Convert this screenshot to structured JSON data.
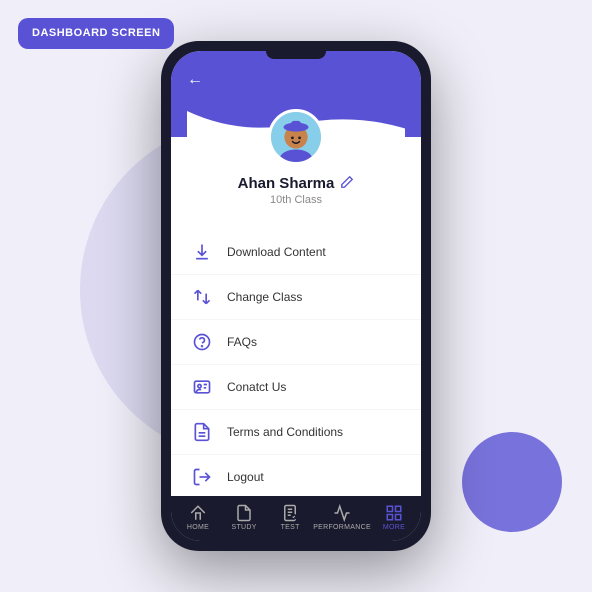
{
  "dashboard_label": "DASHBOARD\nSCREEN",
  "header": {
    "back_label": "←",
    "username": "Ahan Sharma",
    "user_class": "10th Class",
    "edit_icon": "✎"
  },
  "menu_items": [
    {
      "id": "download",
      "label": "Download Content",
      "icon": "download"
    },
    {
      "id": "change_class",
      "label": "Change Class",
      "icon": "switch"
    },
    {
      "id": "faqs",
      "label": "FAQs",
      "icon": "help-circle"
    },
    {
      "id": "contact",
      "label": "Conatct Us",
      "icon": "contact-card"
    },
    {
      "id": "terms",
      "label": "Terms and Conditions",
      "icon": "document"
    },
    {
      "id": "logout",
      "label": "Logout",
      "icon": "logout"
    }
  ],
  "bottom_nav": [
    {
      "id": "home",
      "label": "HOME",
      "active": false
    },
    {
      "id": "study",
      "label": "STUDY",
      "active": false
    },
    {
      "id": "test",
      "label": "TEST",
      "active": false
    },
    {
      "id": "performance",
      "label": "PERFORMANCE",
      "active": false
    },
    {
      "id": "more",
      "label": "MORE",
      "active": true
    }
  ]
}
